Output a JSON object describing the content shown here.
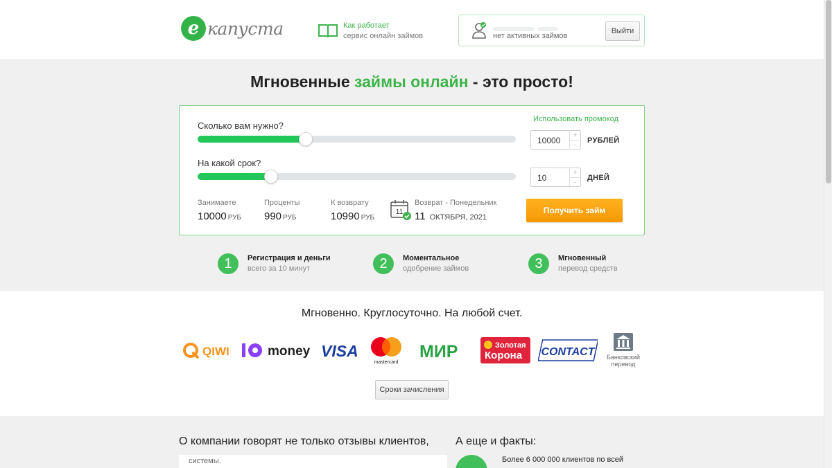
{
  "header": {
    "logo_letter": "e",
    "logo_text": "капуста",
    "how_line1": "Как работает",
    "how_line2": "сервис онлайн займов",
    "user_status": "нет активных займов",
    "logout_label": "Выйти"
  },
  "hero": {
    "title_part1": "Мгновенные ",
    "title_green": "займы онлайн",
    "title_part2": " - это просто!"
  },
  "calculator": {
    "promo_link": "Использовать промокод",
    "amount_question": "Сколько вам нужно?",
    "term_question": "На какой срок?",
    "amount_value": "10000",
    "amount_unit": "РУБЛЕЙ",
    "term_value": "10",
    "term_unit": "ДНЕЙ",
    "amount_slider_fraction": 0.34,
    "term_slider_fraction": 0.23,
    "spin_plus": "+",
    "spin_minus": "-",
    "borrow_label": "Занимаете",
    "borrow_value": "10000",
    "interest_label": "Проценты",
    "interest_value": "990",
    "repay_label": "К возврату",
    "repay_value": "10990",
    "currency": "РУБ",
    "return_label": "Возврат - Понедельник",
    "return_day": "11",
    "return_month_year": "ОКТЯБРЯ, 2021",
    "calendar_day": "11",
    "get_loan_label": "Получить займ"
  },
  "steps": [
    {
      "num": "1",
      "line1": "Регистрация и деньги",
      "line2": "всего за 10 минут"
    },
    {
      "num": "2",
      "line1": "Моментальное",
      "line2": "одобрение займов"
    },
    {
      "num": "3",
      "line1": "Мгновенный",
      "line2": "перевод средств"
    }
  ],
  "payments": {
    "title": "Мгновенно. Круглосуточно. На любой счет.",
    "methods": {
      "qiwi": "QIWI",
      "yoomoney": "money",
      "visa": "VISA",
      "mastercard": "mastercard",
      "mir": "МИР",
      "zolotaya_korona_1": "Золотая",
      "zolotaya_korona_2": "Корона",
      "contact": "CONTACT",
      "bank_1": "Банковский",
      "bank_2": "перевод"
    },
    "terms_button": "Сроки зачисления"
  },
  "bottom": {
    "reviews_title": "О компании говорят не только отзывы клиентов,",
    "review_snippet": "системы.",
    "facts_title": "А еще и факты:",
    "fact_text": "Более 6 000 000 клиентов по всей"
  },
  "colors": {
    "brand_green": "#3cb44a",
    "slider_green": "#22c75a",
    "cta_orange": "#f59805",
    "hero_bg": "#f0f0f0"
  }
}
